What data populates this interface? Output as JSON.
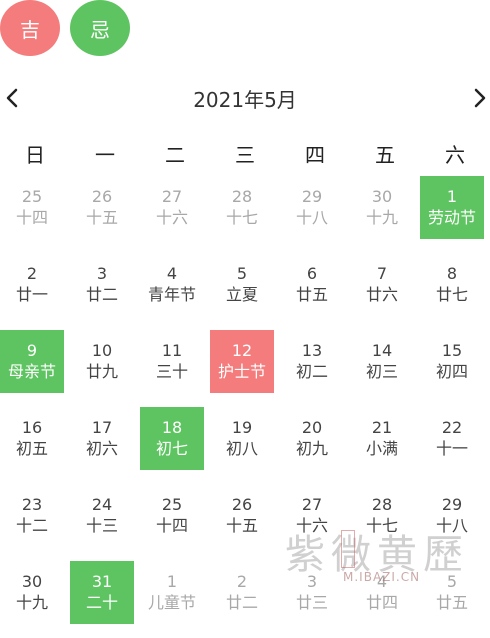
{
  "badges": {
    "auspicious": "吉",
    "avoid": "忌"
  },
  "header": {
    "title": "2021年5月"
  },
  "weekdays": [
    "日",
    "一",
    "二",
    "三",
    "四",
    "五",
    "六"
  ],
  "days": [
    {
      "day": "25",
      "lunar": "十四",
      "other": true,
      "mark": ""
    },
    {
      "day": "26",
      "lunar": "十五",
      "other": true,
      "mark": ""
    },
    {
      "day": "27",
      "lunar": "十六",
      "other": true,
      "mark": ""
    },
    {
      "day": "28",
      "lunar": "十七",
      "other": true,
      "mark": ""
    },
    {
      "day": "29",
      "lunar": "十八",
      "other": true,
      "mark": ""
    },
    {
      "day": "30",
      "lunar": "十九",
      "other": true,
      "mark": ""
    },
    {
      "day": "1",
      "lunar": "劳动节",
      "other": false,
      "mark": "green"
    },
    {
      "day": "2",
      "lunar": "廿一",
      "other": false,
      "mark": ""
    },
    {
      "day": "3",
      "lunar": "廿二",
      "other": false,
      "mark": ""
    },
    {
      "day": "4",
      "lunar": "青年节",
      "other": false,
      "mark": ""
    },
    {
      "day": "5",
      "lunar": "立夏",
      "other": false,
      "mark": ""
    },
    {
      "day": "6",
      "lunar": "廿五",
      "other": false,
      "mark": ""
    },
    {
      "day": "7",
      "lunar": "廿六",
      "other": false,
      "mark": ""
    },
    {
      "day": "8",
      "lunar": "廿七",
      "other": false,
      "mark": ""
    },
    {
      "day": "9",
      "lunar": "母亲节",
      "other": false,
      "mark": "green"
    },
    {
      "day": "10",
      "lunar": "廿九",
      "other": false,
      "mark": ""
    },
    {
      "day": "11",
      "lunar": "三十",
      "other": false,
      "mark": ""
    },
    {
      "day": "12",
      "lunar": "护士节",
      "other": false,
      "mark": "red"
    },
    {
      "day": "13",
      "lunar": "初二",
      "other": false,
      "mark": ""
    },
    {
      "day": "14",
      "lunar": "初三",
      "other": false,
      "mark": ""
    },
    {
      "day": "15",
      "lunar": "初四",
      "other": false,
      "mark": ""
    },
    {
      "day": "16",
      "lunar": "初五",
      "other": false,
      "mark": ""
    },
    {
      "day": "17",
      "lunar": "初六",
      "other": false,
      "mark": ""
    },
    {
      "day": "18",
      "lunar": "初七",
      "other": false,
      "mark": "green"
    },
    {
      "day": "19",
      "lunar": "初八",
      "other": false,
      "mark": ""
    },
    {
      "day": "20",
      "lunar": "初九",
      "other": false,
      "mark": ""
    },
    {
      "day": "21",
      "lunar": "小满",
      "other": false,
      "mark": ""
    },
    {
      "day": "22",
      "lunar": "十一",
      "other": false,
      "mark": ""
    },
    {
      "day": "23",
      "lunar": "十二",
      "other": false,
      "mark": ""
    },
    {
      "day": "24",
      "lunar": "十三",
      "other": false,
      "mark": ""
    },
    {
      "day": "25",
      "lunar": "十四",
      "other": false,
      "mark": ""
    },
    {
      "day": "26",
      "lunar": "十五",
      "other": false,
      "mark": ""
    },
    {
      "day": "27",
      "lunar": "十六",
      "other": false,
      "mark": ""
    },
    {
      "day": "28",
      "lunar": "十七",
      "other": false,
      "mark": ""
    },
    {
      "day": "29",
      "lunar": "十八",
      "other": false,
      "mark": ""
    },
    {
      "day": "30",
      "lunar": "十九",
      "other": false,
      "mark": ""
    },
    {
      "day": "31",
      "lunar": "二十",
      "other": false,
      "mark": "green"
    },
    {
      "day": "1",
      "lunar": "儿童节",
      "other": true,
      "mark": ""
    },
    {
      "day": "2",
      "lunar": "廿二",
      "other": true,
      "mark": ""
    },
    {
      "day": "3",
      "lunar": "廿三",
      "other": true,
      "mark": ""
    },
    {
      "day": "4",
      "lunar": "廿四",
      "other": true,
      "mark": ""
    },
    {
      "day": "5",
      "lunar": "廿五",
      "other": true,
      "mark": ""
    }
  ],
  "watermark": {
    "title": "紫微黄歷",
    "url": "M.IBAZI.CN"
  },
  "colors": {
    "green": "#5ec461",
    "red": "#f47c7c",
    "muted": "#a8a8a8"
  },
  "icons": {
    "prev": "chevron-left-icon",
    "next": "chevron-right-icon"
  }
}
